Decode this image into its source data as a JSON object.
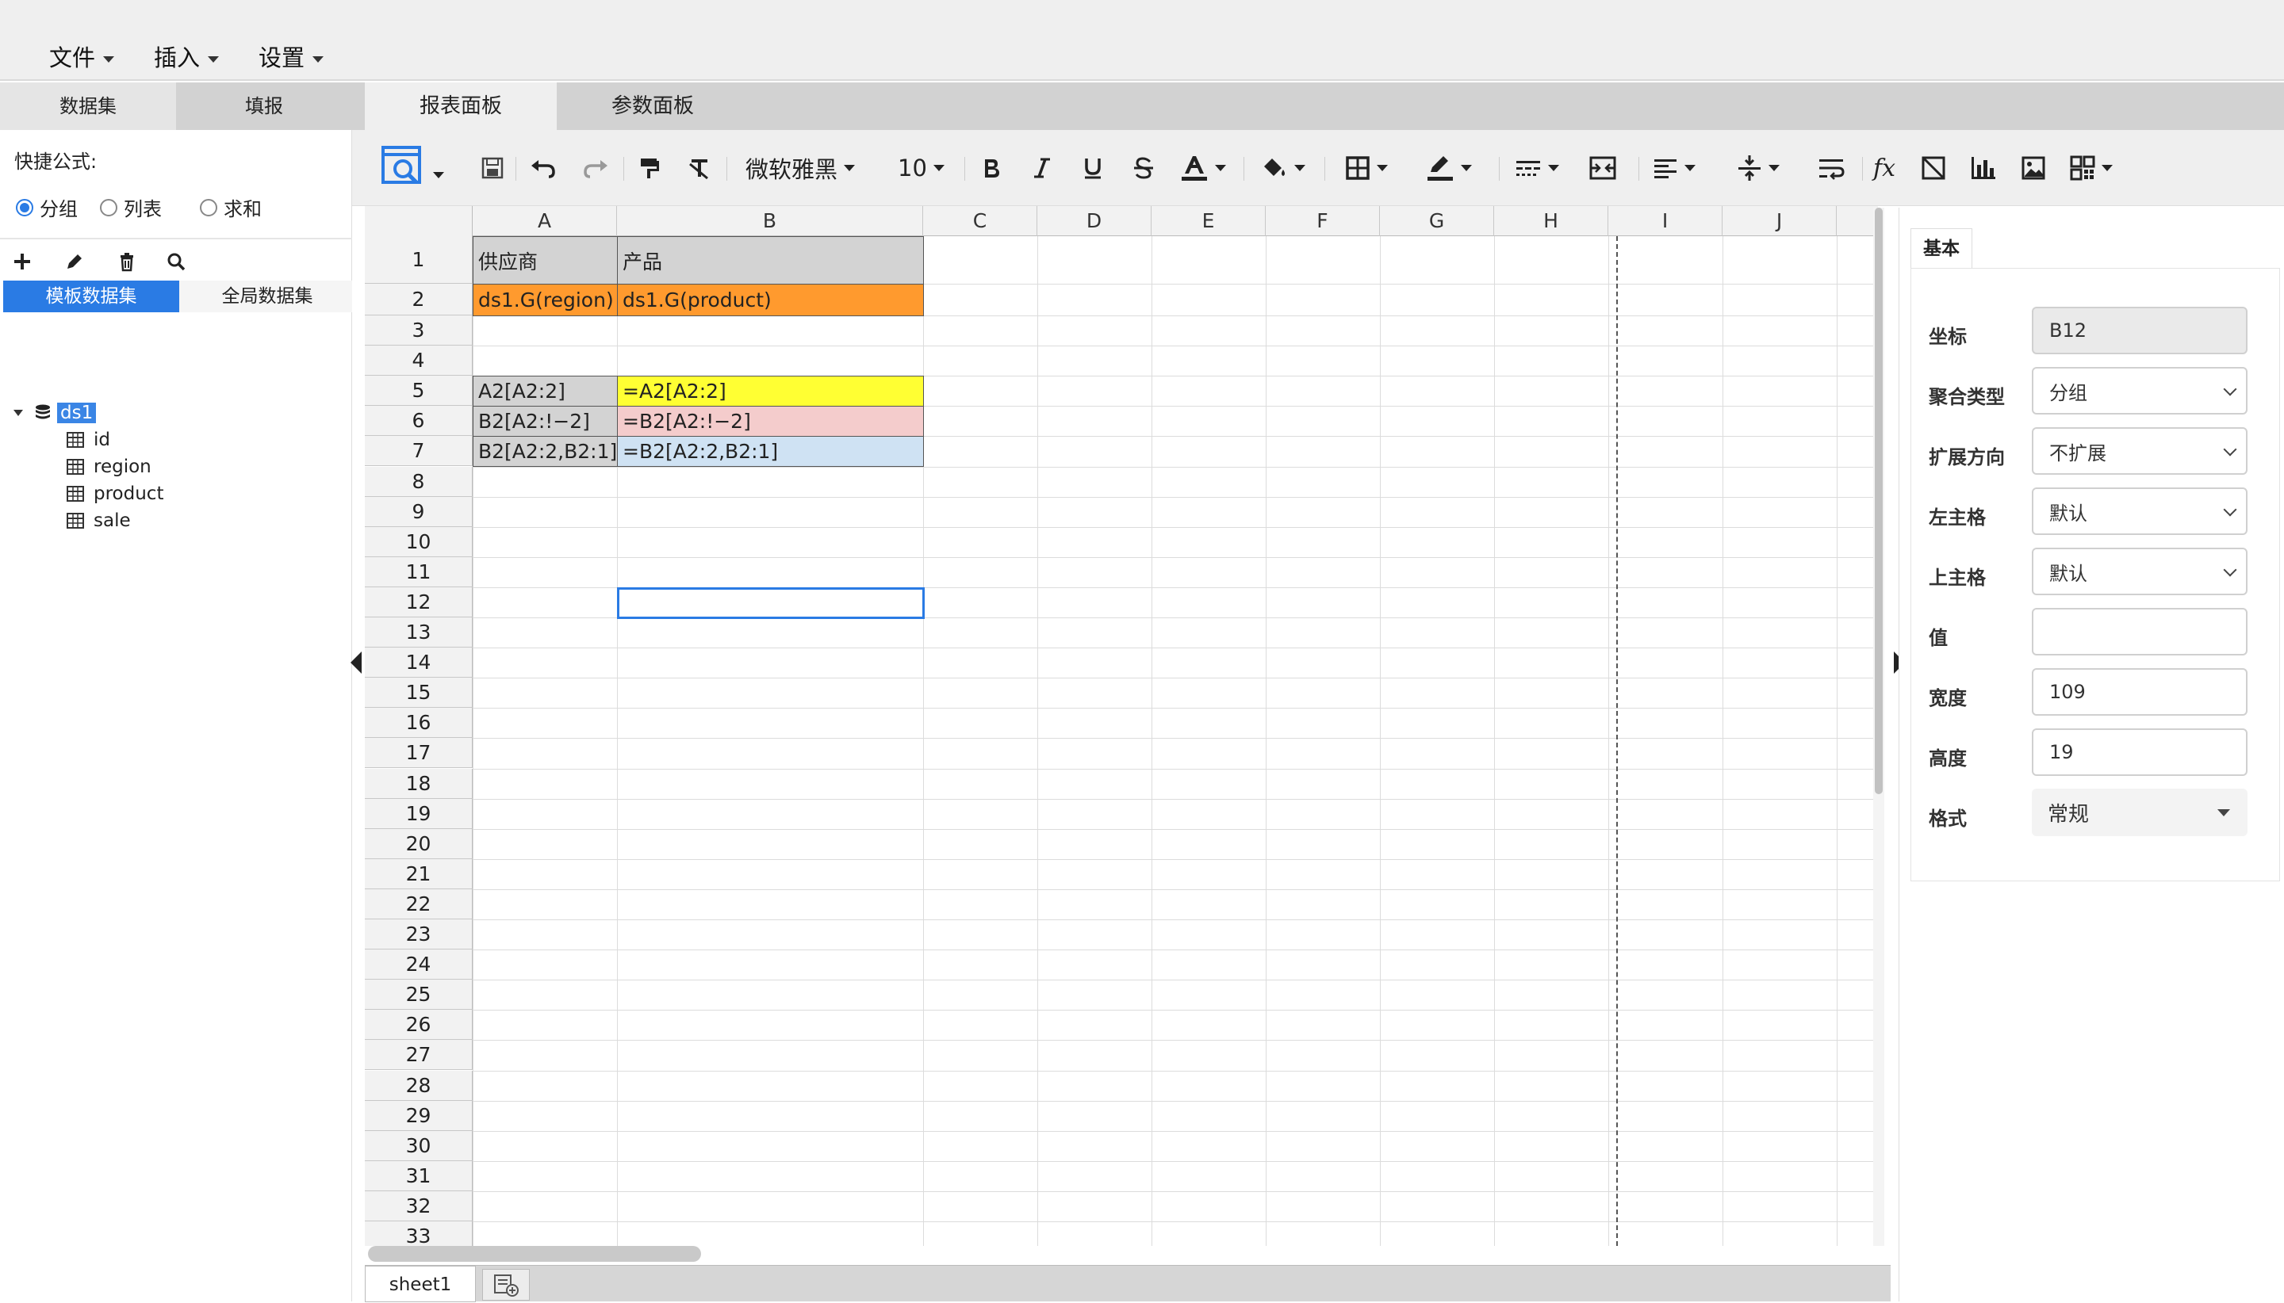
{
  "menubar": {
    "file": "文件",
    "insert": "插入",
    "settings": "设置"
  },
  "left": {
    "tabs": {
      "dataset": "数据集",
      "fill": "填报"
    },
    "quick_formula_label": "快捷公式:",
    "radios": {
      "group": "分组",
      "list": "列表",
      "sum": "求和",
      "selected": "分组"
    },
    "ds_tabs": {
      "template": "模板数据集",
      "global": "全局数据集"
    },
    "tree": {
      "dataset": "ds1",
      "fields": [
        "id",
        "region",
        "product",
        "sale"
      ]
    }
  },
  "center": {
    "tabs": {
      "report": "报表面板",
      "param": "参数面板"
    },
    "toolbar": {
      "font": "微软雅黑",
      "font_size": "10"
    }
  },
  "sheet": {
    "columns": [
      "A",
      "B",
      "C",
      "D",
      "E",
      "F",
      "G",
      "H",
      "I",
      "J"
    ],
    "rows": [
      "1",
      "2",
      "3",
      "4",
      "5",
      "6",
      "7",
      "8",
      "9",
      "10",
      "11",
      "12",
      "13",
      "14",
      "15",
      "16",
      "17",
      "18",
      "19",
      "20",
      "21",
      "22",
      "23",
      "24",
      "25",
      "26",
      "27",
      "28",
      "29",
      "30",
      "31",
      "32",
      "33"
    ],
    "cells": {
      "A1": "供应商",
      "B1": "产品",
      "A2": "ds1.G(region)",
      "B2": "ds1.G(product)",
      "A5": "A2[A2:2]",
      "B5": "=A2[A2:2]",
      "A6": "B2[A2:!−2]",
      "B6": "=B2[A2:!−2]",
      "A7": "B2[A2:2,B2:1]",
      "B7": "=B2[A2:2,B2:1]"
    },
    "tab_name": "sheet1",
    "colors": {
      "orange": "#ff9a2e",
      "yellow": "#ffff33",
      "pink": "#f4cccc",
      "blue": "#cfe2f3",
      "gray": "#d3d3d3",
      "selection": "#2a7be4"
    }
  },
  "props": {
    "tab": "基本",
    "coord_label": "坐标",
    "coord_value": "B12",
    "agg_label": "聚合类型",
    "agg_value": "分组",
    "expand_label": "扩展方向",
    "expand_value": "不扩展",
    "left_parent_label": "左主格",
    "left_parent_value": "默认",
    "top_parent_label": "上主格",
    "top_parent_value": "默认",
    "value_label": "值",
    "value_value": "",
    "width_label": "宽度",
    "width_value": "109",
    "height_label": "高度",
    "height_value": "19",
    "format_label": "格式",
    "format_value": "常规"
  }
}
